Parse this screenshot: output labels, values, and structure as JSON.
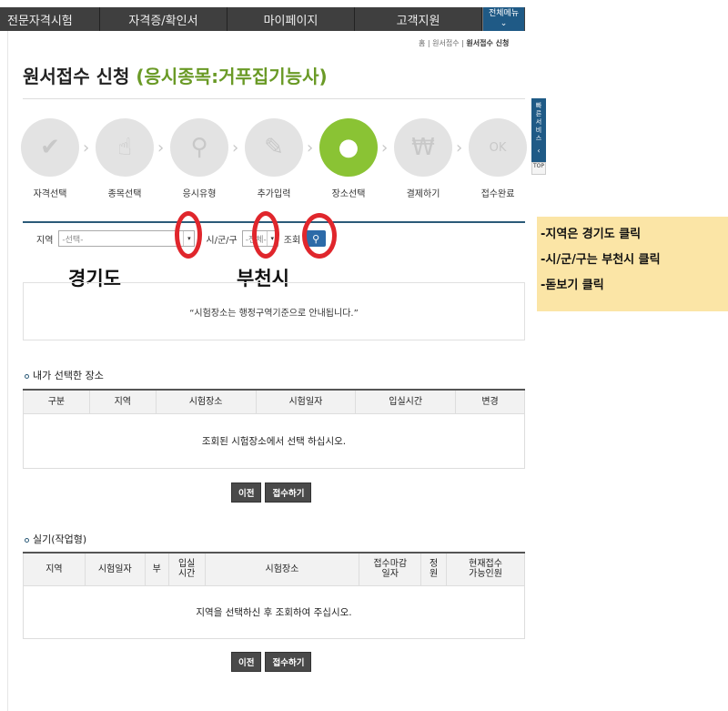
{
  "nav": {
    "items": [
      "전문자격시험",
      "자격증/확인서",
      "마이페이지",
      "고객지원"
    ],
    "all_menu": "전체메뉴"
  },
  "breadcrumb": {
    "home": "홈",
    "sep1": " | 원서접수 | ",
    "current": "원서접수 신청"
  },
  "page": {
    "title": "원서접수 신청",
    "subject": "(응시종목:거푸집기능사)"
  },
  "steps": [
    {
      "label": "자격선택",
      "icon": "✔"
    },
    {
      "label": "종목선택",
      "icon": "☝"
    },
    {
      "label": "응시유형",
      "icon": "⚲"
    },
    {
      "label": "추가입력",
      "icon": "✎"
    },
    {
      "label": "장소선택",
      "icon": "●"
    },
    {
      "label": "결제하기",
      "icon": "₩"
    },
    {
      "label": "접수완료",
      "icon": "OK"
    }
  ],
  "quick": {
    "label": "빠른서비스",
    "top": "TOP"
  },
  "filter": {
    "region_label": "지역",
    "region_placeholder": "-선택-",
    "city_label": "시/군/구",
    "city_placeholder": "-전체-",
    "lookup_label": "조회"
  },
  "annotations": {
    "region_hint": "경기도",
    "city_hint": "부천시",
    "callout": [
      "-지역은 경기도 클릭",
      "-시/군/구는 부천시 클릭",
      "-돋보기 클릭"
    ]
  },
  "notice": "“시험장소는 행정구역기준으로 안내됩니다.”",
  "selected": {
    "title": "내가 선택한 장소",
    "columns": [
      "구분",
      "지역",
      "시험장소",
      "시험일자",
      "입실시간",
      "변경"
    ],
    "empty": "조회된 시험장소에서 선택 하십시오."
  },
  "practical": {
    "title": "실기(작업형)",
    "columns": [
      "지역",
      "시험일자",
      "부",
      "입실\n시간",
      "시험장소",
      "접수마감\n일자",
      "정\n원",
      "현재접수\n가능인원"
    ],
    "empty": "지역을 선택하신 후 조회하여 주십시오."
  },
  "buttons": {
    "prev": "이전",
    "submit": "접수하기"
  }
}
